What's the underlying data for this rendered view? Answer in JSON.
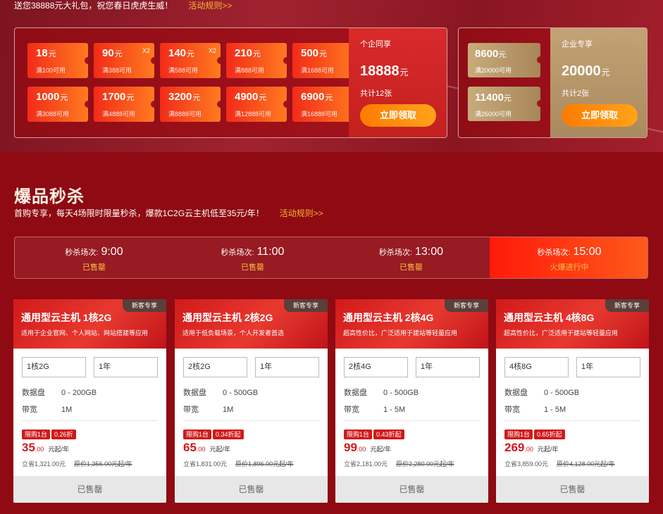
{
  "promo": {
    "text": "送您38888元大礼包，祝您春日虎虎生威！",
    "rules": "活动规则>>"
  },
  "coupons": {
    "items": [
      {
        "amount": "18",
        "unit": "元",
        "cond": "满100可用",
        "x2": ""
      },
      {
        "amount": "90",
        "unit": "元",
        "cond": "满388可用",
        "x2": "X2"
      },
      {
        "amount": "140",
        "unit": "元",
        "cond": "满588可用",
        "x2": "X2"
      },
      {
        "amount": "210",
        "unit": "元",
        "cond": "满888可用",
        "x2": ""
      },
      {
        "amount": "500",
        "unit": "元",
        "cond": "满1688可用",
        "x2": ""
      },
      {
        "amount": "1000",
        "unit": "元",
        "cond": "满3088可用",
        "x2": ""
      },
      {
        "amount": "1700",
        "unit": "元",
        "cond": "满4888可用",
        "x2": ""
      },
      {
        "amount": "3200",
        "unit": "元",
        "cond": "满8888可用",
        "x2": ""
      },
      {
        "amount": "4900",
        "unit": "元",
        "cond": "满12888可用",
        "x2": ""
      },
      {
        "amount": "6900",
        "unit": "元",
        "cond": "满16888可用",
        "x2": ""
      }
    ],
    "side": {
      "title": "个企同享",
      "amount": "18888",
      "unit": "元",
      "count": "共计12张",
      "button": "立即领取"
    }
  },
  "enterprise": {
    "items": [
      {
        "amount": "8600",
        "unit": "元",
        "cond": "满20000可用"
      },
      {
        "amount": "11400",
        "unit": "元",
        "cond": "满26000可用"
      }
    ],
    "side": {
      "title": "企业专享",
      "amount": "20000",
      "unit": "元",
      "count": "共计2张",
      "button": "立即领取"
    }
  },
  "flash": {
    "title": "爆品秒杀",
    "subtitle": "首购专享，每天4场限时限量秒杀，爆款1C2G云主机低至35元/年！",
    "rules": "活动规则>>",
    "sessions": [
      {
        "label": "秒杀场次:",
        "time": "9:00",
        "status": "已售罄"
      },
      {
        "label": "秒杀场次:",
        "time": "11:00",
        "status": "已售罄"
      },
      {
        "label": "秒杀场次:",
        "time": "13:00",
        "status": "已售罄"
      },
      {
        "label": "秒杀场次:",
        "time": "15:00",
        "status": "火爆进行中"
      }
    ]
  },
  "products": [
    {
      "tag": "新客专享",
      "name": "通用型云主机 1核2G",
      "desc": "适用于企业官网、个人网站、网站搭建等应用",
      "config": "1核2G",
      "duration": "1年",
      "disk_label": "数据盘",
      "disk": "0 - 200GB",
      "bw_label": "带宽",
      "bw": "1M",
      "limit": "限购1台",
      "discount": "0.26折",
      "price": "35",
      "price_dec": ".00",
      "price_unit": "元起/年",
      "save": "立省1,321.00元",
      "orig": "原价1,356.00元起/年",
      "sold": "已售罄"
    },
    {
      "tag": "新客专享",
      "name": "通用型云主机 2核2G",
      "desc": "适用于低负载场景，个人开发者首选",
      "config": "2核2G",
      "duration": "1年",
      "disk_label": "数据盘",
      "disk": "0 - 500GB",
      "bw_label": "带宽",
      "bw": "1M",
      "limit": "限购1台",
      "discount": "0.34折起",
      "price": "65",
      "price_dec": ".00",
      "price_unit": "元起/年",
      "save": "立省1,831.00元",
      "orig": "原价1,896.00元起/年",
      "sold": "已售罄"
    },
    {
      "tag": "新客专享",
      "name": "通用型云主机 2核4G",
      "desc": "超高性价比，广泛适用于建站等轻量应用",
      "config": "2核4G",
      "duration": "1年",
      "disk_label": "数据盘",
      "disk": "0 - 500GB",
      "bw_label": "带宽",
      "bw": "1 - 5M",
      "limit": "限购1台",
      "discount": "0.43折起",
      "price": "99",
      "price_dec": ".00",
      "price_unit": "元起/年",
      "save": "立省2,181.00元",
      "orig": "原价2,280.00元起/年",
      "sold": "已售罄"
    },
    {
      "tag": "新客专享",
      "name": "通用型云主机 4核8G",
      "desc": "超高性价比，广泛适用于建站等轻量应用",
      "config": "4核8G",
      "duration": "1年",
      "disk_label": "数据盘",
      "disk": "0 - 500GB",
      "bw_label": "带宽",
      "bw": "1 - 5M",
      "limit": "限购1台",
      "discount": "0.65折起",
      "price": "269",
      "price_dec": ".00",
      "price_unit": "元起/年",
      "save": "立省3,859.00元",
      "orig": "原价4,128.00元起/年",
      "sold": "已售罄"
    }
  ]
}
